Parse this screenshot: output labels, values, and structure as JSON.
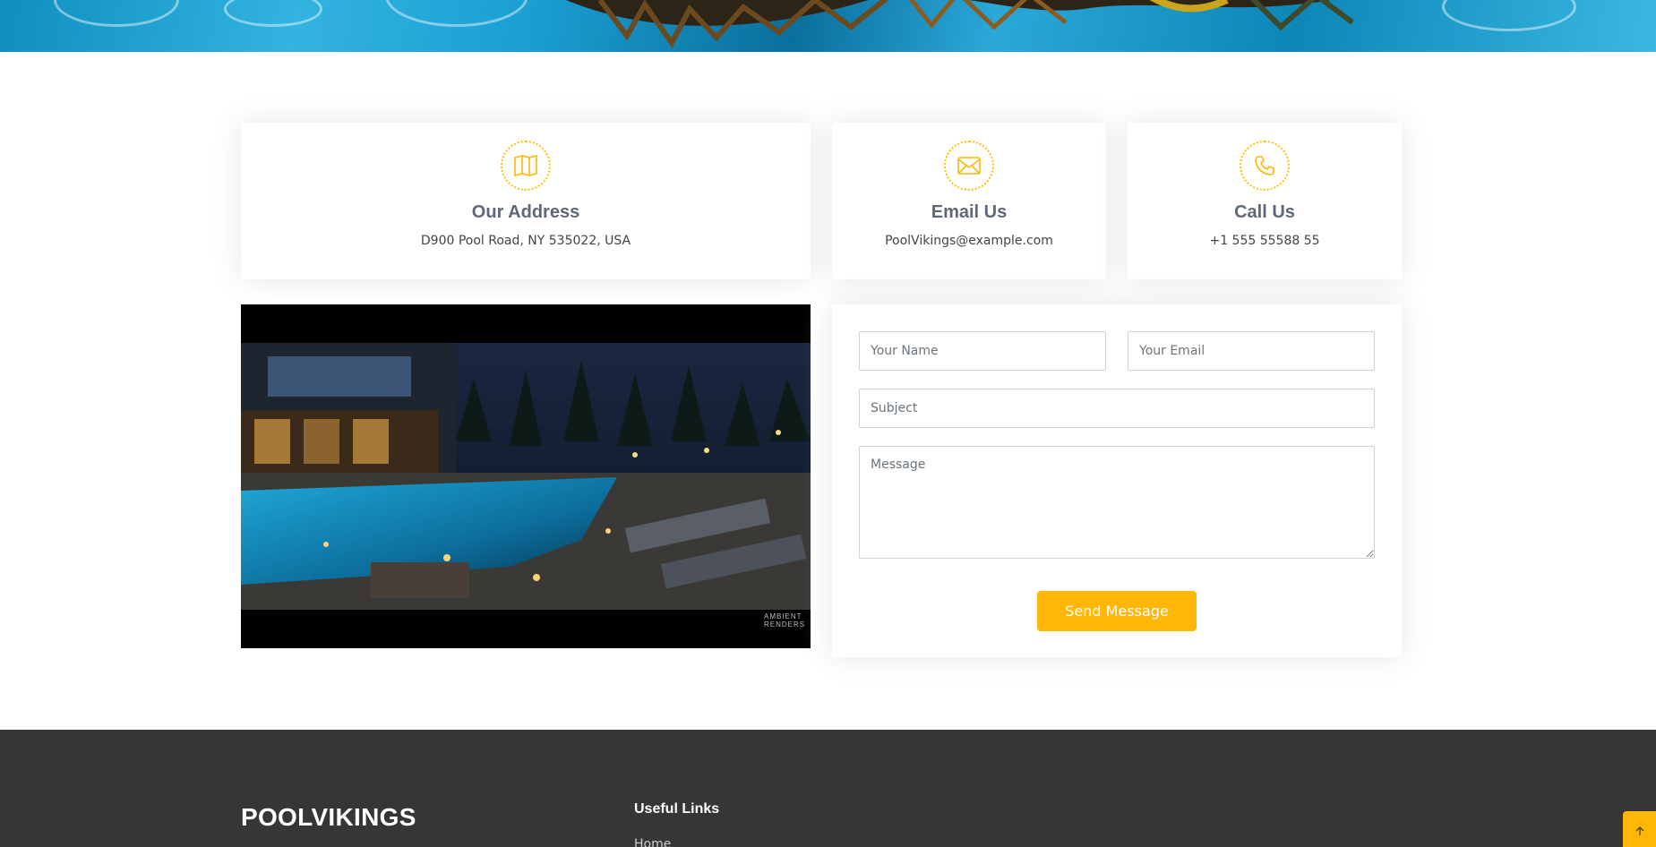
{
  "info_cards": [
    {
      "title": "Our Address",
      "text": "D900 Pool Road, NY 535022, USA",
      "icon": "map-icon"
    },
    {
      "title": "Email Us",
      "text": "PoolVikings@example.com",
      "icon": "envelope-icon"
    },
    {
      "title": "Call Us",
      "text": "+1 555 55588 55",
      "icon": "phone-icon"
    }
  ],
  "photo": {
    "watermark_line1": "AMBIENT",
    "watermark_line2": "RENDERS"
  },
  "form": {
    "name_placeholder": "Your Name",
    "email_placeholder": "Your Email",
    "subject_placeholder": "Subject",
    "message_placeholder": "Message",
    "submit_label": "Send Message"
  },
  "footer": {
    "brand": "POOLVIKINGS",
    "links_heading": "Useful Links",
    "links": [
      "Home"
    ]
  },
  "colors": {
    "accent": "#ffb605",
    "footer_bg": "#363636",
    "heading": "#5f687b"
  },
  "back_to_top_icon": "arrow-up-icon"
}
